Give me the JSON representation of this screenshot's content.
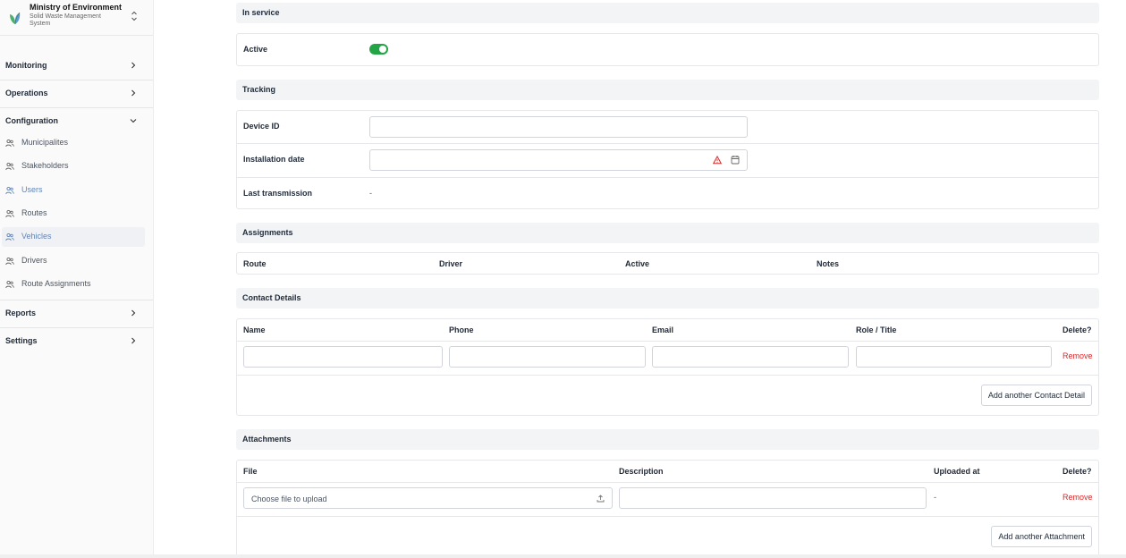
{
  "brand": {
    "title": "Ministry of Environment",
    "subtitle": "Solid Waste Management System"
  },
  "nav": {
    "monitoring": "Monitoring",
    "operations": "Operations",
    "configuration": "Configuration",
    "reports": "Reports",
    "settings": "Settings",
    "config_items": [
      {
        "label": "Municipalites"
      },
      {
        "label": "Stakeholders"
      },
      {
        "label": "Users"
      },
      {
        "label": "Routes"
      },
      {
        "label": "Vehicles"
      },
      {
        "label": "Drivers"
      },
      {
        "label": "Route Assignments"
      }
    ]
  },
  "in_service": {
    "title": "In service",
    "active_label": "Active",
    "active": true
  },
  "tracking": {
    "title": "Tracking",
    "device_id_label": "Device ID",
    "device_id_value": "",
    "installation_date_label": "Installation date",
    "installation_date_value": "",
    "last_transmission_label": "Last transmission",
    "last_transmission_value": "-"
  },
  "assignments": {
    "title": "Assignments",
    "columns": [
      "Route",
      "Driver",
      "Active",
      "Notes"
    ]
  },
  "contacts": {
    "title": "Contact Details",
    "columns": [
      "Name",
      "Phone",
      "Email",
      "Role / Title",
      "Delete?"
    ],
    "remove_label": "Remove",
    "add_label": "Add another Contact Detail"
  },
  "attachments": {
    "title": "Attachments",
    "columns": [
      "File",
      "Description",
      "Uploaded at",
      "Delete?"
    ],
    "file_placeholder": "Choose file to upload",
    "uploaded_at_value": "-",
    "remove_label": "Remove",
    "add_label": "Add another Attachment"
  },
  "colors": {
    "toggle_on": "#22a447",
    "remove": "#dc2626",
    "active_nav": "#6485b5",
    "warning": "#dc2626"
  }
}
